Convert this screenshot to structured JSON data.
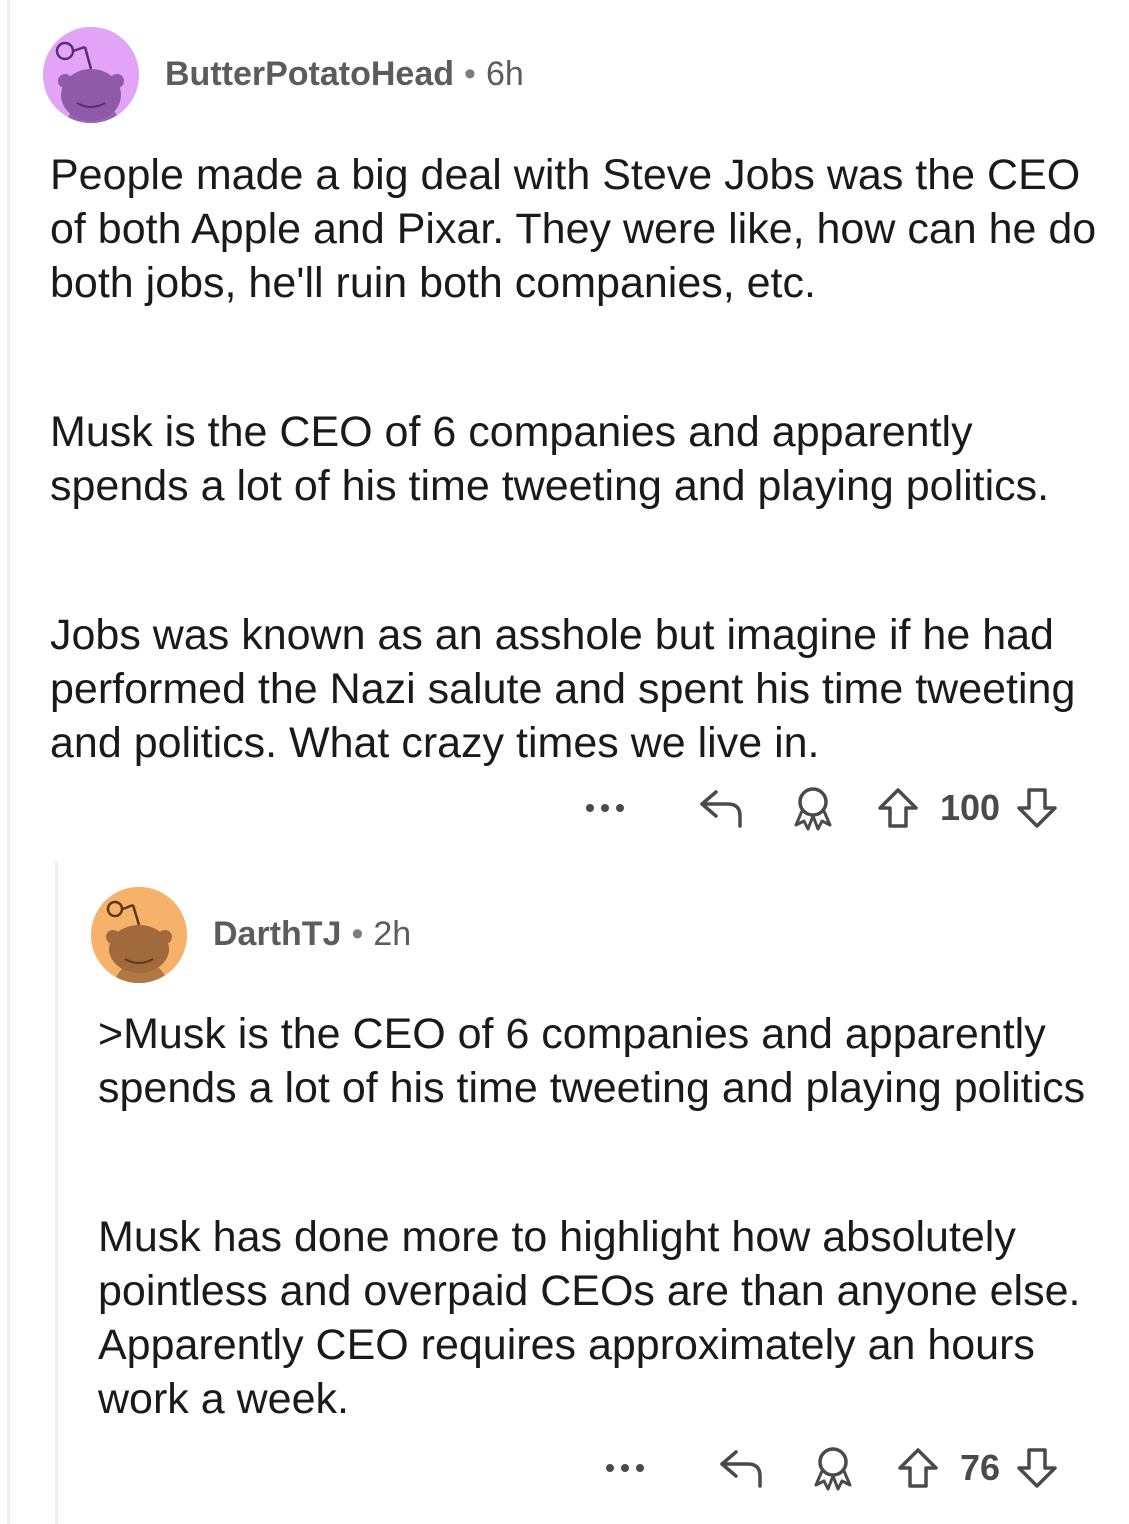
{
  "comments": [
    {
      "username": "ButterPotatoHead",
      "separator": "•",
      "age": "6h",
      "avatar_bg": "#e3a3f7",
      "paragraphs": [
        "People made a big deal with Steve Jobs was the CEO of both Apple and Pixar. They were like, how can he do both jobs, he'll ruin both companies, etc.",
        "Musk is the CEO of 6 companies and apparently spends a lot of his time tweeting and playing politics.",
        "Jobs was known as an asshole but imagine if he had performed the Nazi salute and spent his time tweeting and politics. What crazy times we live in."
      ],
      "score": "100",
      "more_icon": "ellipsis-icon",
      "reply_icon": "reply-arrow-icon",
      "award_icon": "award-icon",
      "upvote_icon": "upvote-arrow-icon",
      "downvote_icon": "downvote-arrow-icon"
    },
    {
      "username": "DarthTJ",
      "separator": "•",
      "age": "2h",
      "avatar_bg": "#f6b26b",
      "paragraphs": [
        ">Musk is the CEO of 6 companies and apparently spends a lot of his time tweeting and playing politics",
        "Musk has done more to highlight how absolutely pointless and overpaid CEOs are than anyone else.  Apparently CEO requires approximately an hours work a week."
      ],
      "score": "76",
      "more_icon": "ellipsis-icon",
      "reply_icon": "reply-arrow-icon",
      "award_icon": "award-icon",
      "upvote_icon": "upvote-arrow-icon",
      "downvote_icon": "downvote-arrow-icon"
    }
  ],
  "colors": {
    "text": "#1a1a1b",
    "meta": "#5c5c5c",
    "thread_line": "#eeeeee",
    "icon": "#4a4a4a"
  }
}
